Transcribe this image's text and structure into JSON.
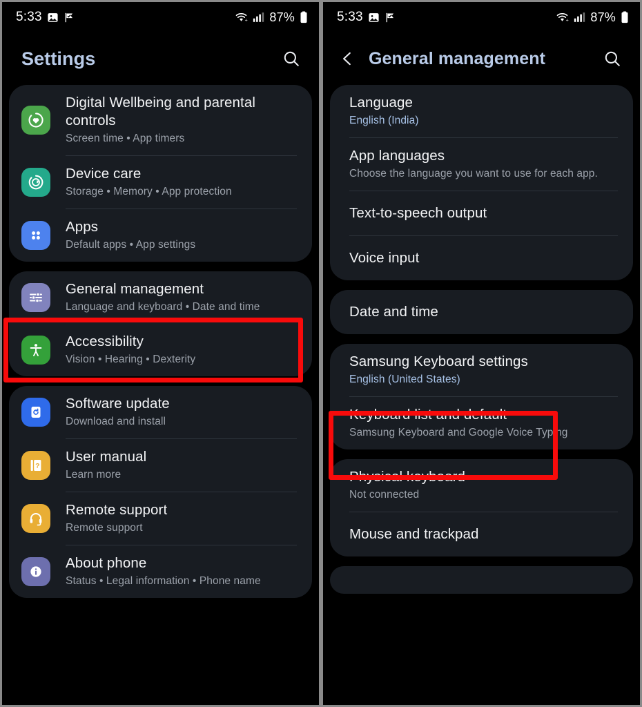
{
  "theme": {
    "accent_text": "#b9cbe8",
    "card_bg": "#181c22",
    "page_bg": "#000000",
    "highlight_box": "#f80b0b",
    "subtitle": "#9ca2ab",
    "link_blue": "#a8c3e8"
  },
  "status_bar": {
    "time": "5:33",
    "battery_percent": "87%",
    "icons": [
      "image-icon",
      "flag-check-icon",
      "wifi-icon",
      "signal-bars-icon",
      "battery-icon"
    ]
  },
  "left_screen": {
    "title": "Settings",
    "search_icon": "search-icon",
    "groups": [
      {
        "items": [
          {
            "title": "Digital Wellbeing and parental controls",
            "subtitle": "Screen time  •  App timers",
            "icon": "wellbeing-heart-icon",
            "icon_color": "#4ba64b"
          },
          {
            "title": "Device care",
            "subtitle": "Storage  •  Memory  •  App protection",
            "icon": "device-care-icon",
            "icon_color": "#24a98b"
          },
          {
            "title": "Apps",
            "subtitle": "Default apps  •  App settings",
            "icon": "apps-grid-icon",
            "icon_color": "#4d82ee"
          }
        ]
      },
      {
        "items": [
          {
            "title": "General management",
            "subtitle": "Language and keyboard  •  Date and time",
            "icon": "sliders-icon",
            "icon_color": "#8183bd",
            "highlighted": true
          },
          {
            "title": "Accessibility",
            "subtitle": "Vision  •  Hearing  •  Dexterity",
            "icon": "accessibility-icon",
            "icon_color": "#34a13a"
          }
        ]
      },
      {
        "items": [
          {
            "title": "Software update",
            "subtitle": "Download and install",
            "icon": "software-update-icon",
            "icon_color": "#2f6bea"
          },
          {
            "title": "User manual",
            "subtitle": "Learn more",
            "icon": "manual-book-icon",
            "icon_color": "#e9ae35"
          },
          {
            "title": "Remote support",
            "subtitle": "Remote support",
            "icon": "headset-icon",
            "icon_color": "#e9ae35"
          },
          {
            "title": "About phone",
            "subtitle": "Status  •  Legal information  •  Phone name",
            "icon": "info-icon",
            "icon_color": "#6d6fae"
          }
        ]
      }
    ]
  },
  "right_screen": {
    "title": "General management",
    "back_icon": "chevron-left-icon",
    "search_icon": "search-icon",
    "groups": [
      {
        "items": [
          {
            "title": "Language",
            "subtitle": "English (India)",
            "subtitle_accent": true
          },
          {
            "title": "App languages",
            "subtitle": "Choose the language you want to use for each app."
          },
          {
            "title": "Text-to-speech output",
            "subtitle": ""
          },
          {
            "title": "Voice input",
            "subtitle": ""
          }
        ]
      },
      {
        "items": [
          {
            "title": "Date and time",
            "subtitle": ""
          }
        ]
      },
      {
        "items": [
          {
            "title": "Samsung Keyboard settings",
            "subtitle": "English (United States)",
            "subtitle_accent": true,
            "highlighted": true
          },
          {
            "title": "Keyboard list and default",
            "subtitle": "Samsung Keyboard and Google Voice Typing"
          }
        ]
      },
      {
        "items": [
          {
            "title": "Physical keyboard",
            "subtitle": "Not connected"
          },
          {
            "title": "Mouse and trackpad",
            "subtitle": ""
          }
        ]
      }
    ]
  }
}
